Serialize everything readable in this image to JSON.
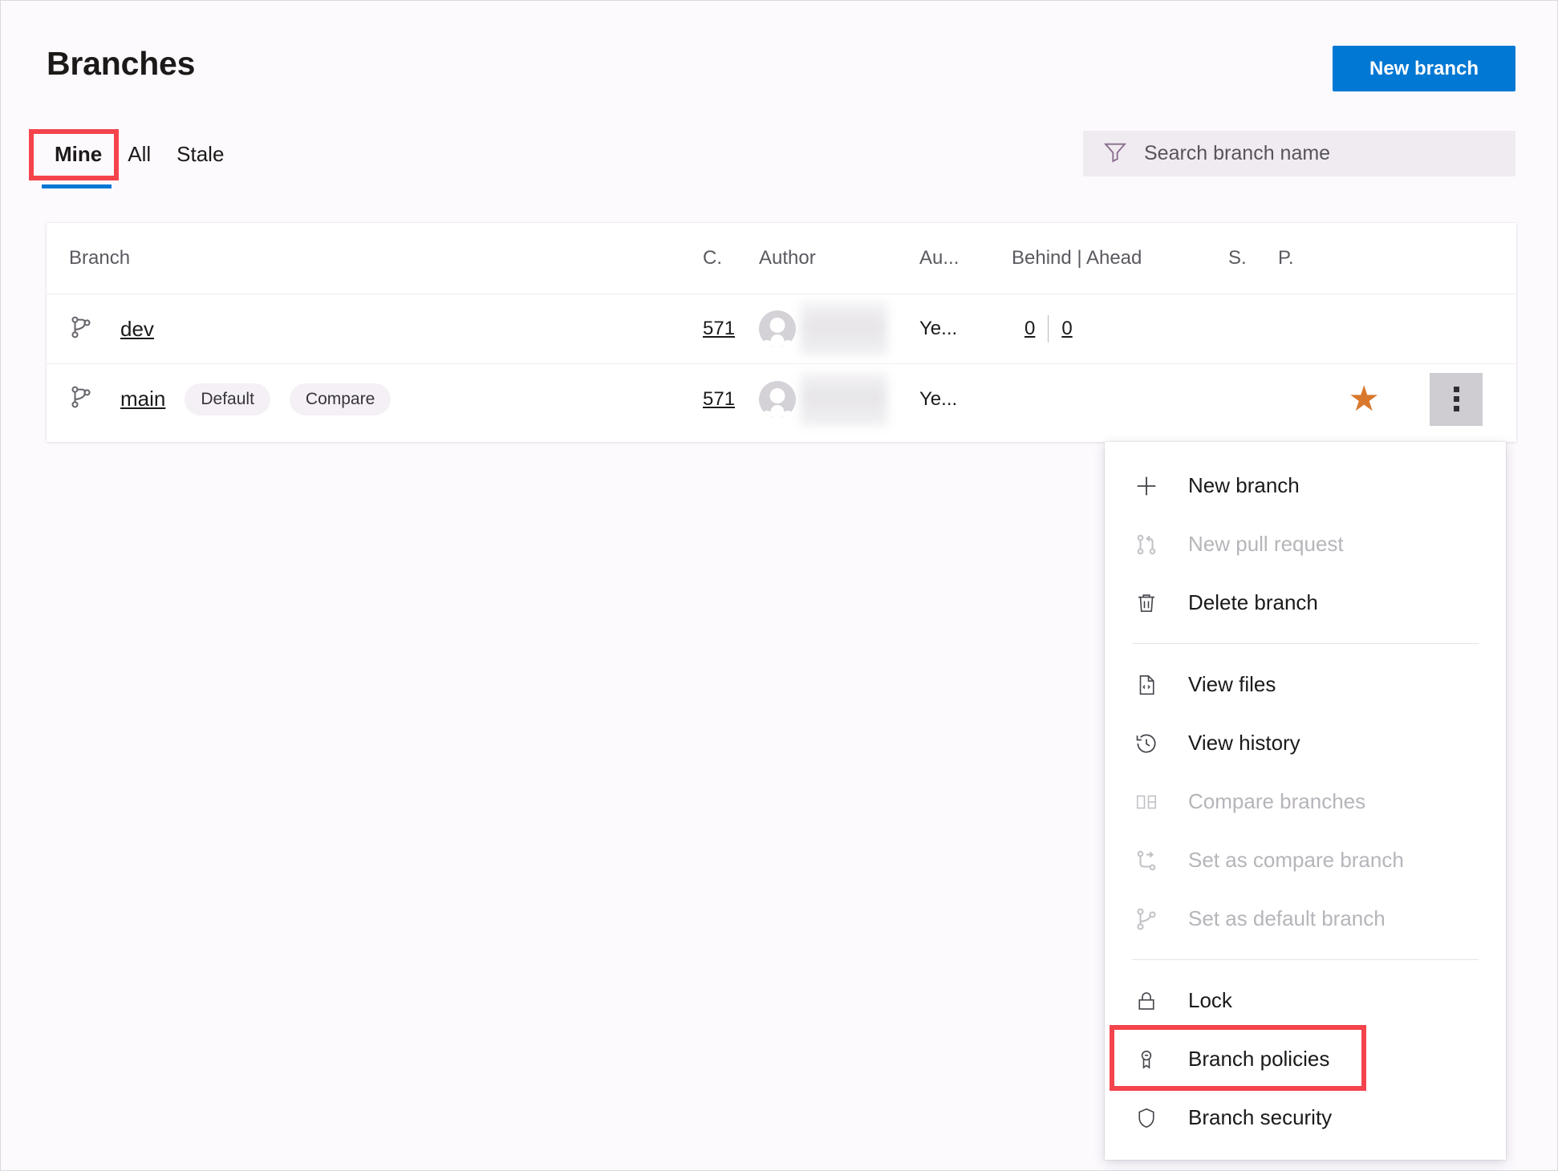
{
  "header": {
    "title": "Branches",
    "new_branch_label": "New branch",
    "accent_color": "#0178d4",
    "highlight_color": "#f4434b"
  },
  "tabs": [
    {
      "label": "Mine",
      "selected": true,
      "highlighted": true
    },
    {
      "label": "All",
      "selected": false,
      "highlighted": false
    },
    {
      "label": "Stale",
      "selected": false,
      "highlighted": false
    }
  ],
  "search": {
    "icon": "filter-icon",
    "placeholder": "Search branch name",
    "value": ""
  },
  "table": {
    "columns": [
      {
        "key": "branch",
        "label": "Branch"
      },
      {
        "key": "commit",
        "label": "C."
      },
      {
        "key": "author",
        "label": "Author"
      },
      {
        "key": "authored",
        "label": "Au..."
      },
      {
        "key": "behind_ahead",
        "label": "Behind | Ahead"
      },
      {
        "key": "status",
        "label": "S."
      },
      {
        "key": "pr",
        "label": "P."
      }
    ],
    "rows": [
      {
        "icon": "branch-icon",
        "name": "dev",
        "tags": [],
        "commit": "571",
        "author_name": "",
        "authored": "Ye...",
        "behind": "0",
        "ahead": "0",
        "favorite": false,
        "menu_open": false
      },
      {
        "icon": "branch-icon",
        "name": "main",
        "tags": [
          "Default",
          "Compare"
        ],
        "commit": "571",
        "author_name": "",
        "authored": "Ye...",
        "behind": "",
        "ahead": "",
        "favorite": true,
        "menu_open": true
      }
    ]
  },
  "context_menu": {
    "groups": [
      {
        "items": [
          {
            "icon": "plus-icon",
            "label": "New branch",
            "disabled": false,
            "highlighted": false
          },
          {
            "icon": "pull-request-icon",
            "label": "New pull request",
            "disabled": true,
            "highlighted": false
          },
          {
            "icon": "trash-icon",
            "label": "Delete branch",
            "disabled": false,
            "highlighted": false
          }
        ]
      },
      {
        "items": [
          {
            "icon": "file-code-icon",
            "label": "View files",
            "disabled": false,
            "highlighted": false
          },
          {
            "icon": "history-icon",
            "label": "View history",
            "disabled": false,
            "highlighted": false
          },
          {
            "icon": "compare-icon",
            "label": "Compare branches",
            "disabled": true,
            "highlighted": false
          },
          {
            "icon": "set-compare-icon",
            "label": "Set as compare branch",
            "disabled": true,
            "highlighted": false
          },
          {
            "icon": "branch-icon",
            "label": "Set as default branch",
            "disabled": true,
            "highlighted": false
          }
        ]
      },
      {
        "items": [
          {
            "icon": "lock-icon",
            "label": "Lock",
            "disabled": false,
            "highlighted": false
          },
          {
            "icon": "ribbon-icon",
            "label": "Branch policies",
            "disabled": false,
            "highlighted": true
          },
          {
            "icon": "shield-icon",
            "label": "Branch security",
            "disabled": false,
            "highlighted": false
          }
        ]
      }
    ]
  }
}
